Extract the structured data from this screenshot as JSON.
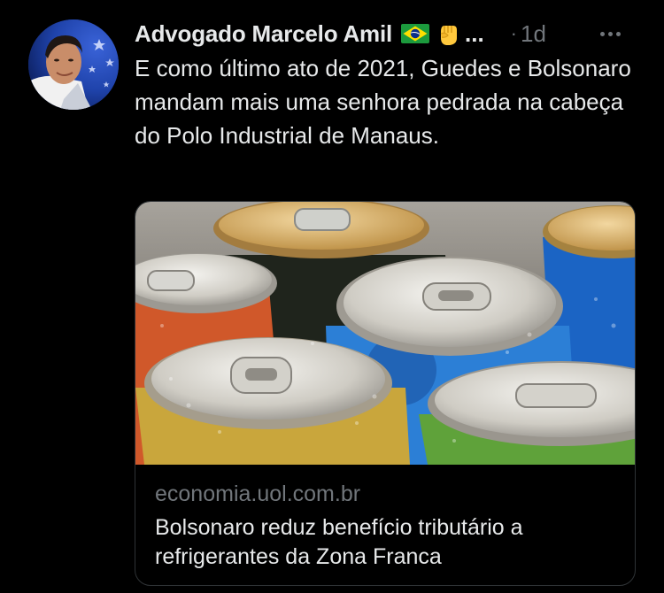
{
  "tweet": {
    "author": "Advogado Marcelo Amil",
    "name_ellipsis": "...",
    "separator": "·",
    "time": "1d",
    "text": "E como último ato de 2021, Guedes e Bolsonaro mandam mais uma senhora pedrada na cabeça do Polo Industrial de Manaus.",
    "icons": {
      "avatar": "user-photo-avatar",
      "flag": "brazil-flag-emoji",
      "fist": "raised-fist-emoji",
      "more": "more-options-icon"
    }
  },
  "link_card": {
    "image": "aluminum-soda-cans-photo",
    "domain": "economia.uol.com.br",
    "title": "Bolsonaro reduz benefício tributário a refrigerantes da Zona Franca"
  },
  "colors": {
    "background": "#000000",
    "text": "#e7e9ea",
    "muted": "#71767b",
    "border": "#2f3336"
  }
}
